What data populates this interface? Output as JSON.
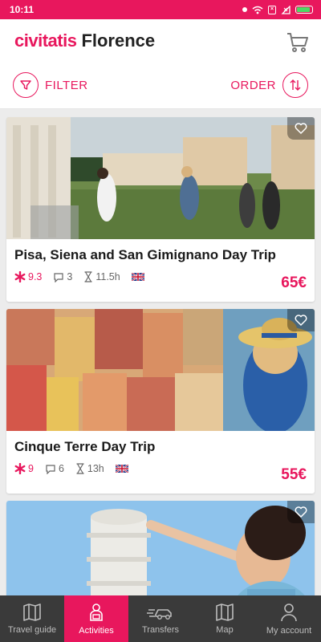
{
  "status": {
    "time": "10:11"
  },
  "header": {
    "brand": "civitatis",
    "city": "Florence"
  },
  "toolbar": {
    "filter_label": "FILTER",
    "order_label": "ORDER"
  },
  "colors": {
    "accent": "#e8175d",
    "nav_bg": "#3a3a3a"
  },
  "activities": [
    {
      "title": "Pisa, Siena and San Gimignano Day Trip",
      "rating": "9.3",
      "comments": "3",
      "duration": "11.5h",
      "language": "uk-flag-icon",
      "price": "65€"
    },
    {
      "title": "Cinque Terre Day Trip",
      "rating": "9",
      "comments": "6",
      "duration": "13h",
      "language": "uk-flag-icon",
      "price": "55€"
    }
  ],
  "nav": [
    {
      "label": "Travel guide",
      "icon": "map-book-icon"
    },
    {
      "label": "Activities",
      "icon": "person-icon",
      "active": true
    },
    {
      "label": "Transfers",
      "icon": "car-icon"
    },
    {
      "label": "Map",
      "icon": "map-icon"
    },
    {
      "label": "My account",
      "icon": "user-icon"
    }
  ]
}
